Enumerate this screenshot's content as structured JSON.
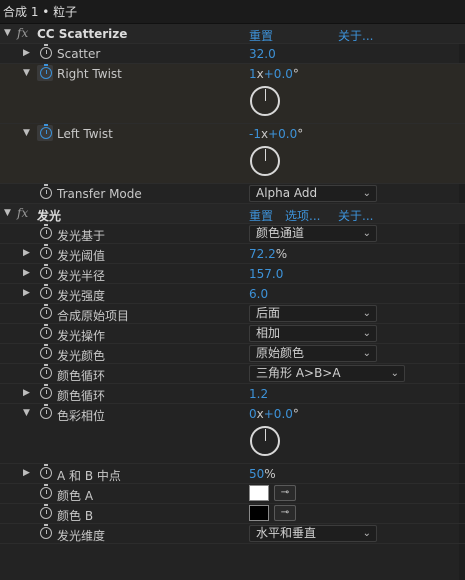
{
  "header": {
    "title": "合成 1 • 粒子",
    "menu_glyph": "≡"
  },
  "effects": [
    {
      "name": "CC Scatterize",
      "links": [
        "重置",
        "关于..."
      ],
      "params": [
        {
          "name": "Scatter",
          "value": "32.0"
        },
        {
          "name": "Right Twist",
          "revolutions": "1",
          "degrees": "+0.0",
          "angle_deg": 0
        },
        {
          "name": "Left Twist",
          "revolutions": "-1",
          "degrees": "+0.0",
          "angle_deg": 0
        },
        {
          "name": "Transfer Mode",
          "dropdown": "Alpha Add"
        }
      ]
    },
    {
      "name": "发光",
      "links": [
        "重置",
        "选项...",
        "关于..."
      ],
      "params": [
        {
          "name": "发光基于",
          "dropdown": "颜色通道"
        },
        {
          "name": "发光阈值",
          "value": "72.2",
          "unit": "%"
        },
        {
          "name": "发光半径",
          "value": "157.0"
        },
        {
          "name": "发光强度",
          "value": "6.0"
        },
        {
          "name": "合成原始项目",
          "dropdown": "后面"
        },
        {
          "name": "发光操作",
          "dropdown": "相加"
        },
        {
          "name": "发光颜色",
          "dropdown": "原始颜色"
        },
        {
          "name": "颜色循环",
          "dropdown": "三角形 A>B>A"
        },
        {
          "name": "颜色循环",
          "value": "1.2"
        },
        {
          "name": "色彩相位",
          "revolutions": "0",
          "degrees": "+0.0",
          "angle_deg": 0
        },
        {
          "name": "A 和 B 中点",
          "value": "50",
          "unit": "%"
        },
        {
          "name": "颜色 A",
          "color": "#ffffff"
        },
        {
          "name": "颜色 B",
          "color": "#000000"
        },
        {
          "name": "发光维度",
          "dropdown": "水平和垂直"
        }
      ]
    }
  ],
  "glyphs": {
    "x_suffix": "x",
    "degree": "°",
    "fx": "fx",
    "eyedropper": "⊸"
  },
  "colors": {
    "accent": "#3d92d8",
    "panel_bg": "#232323",
    "selected_row_bg": "#2b2925"
  }
}
